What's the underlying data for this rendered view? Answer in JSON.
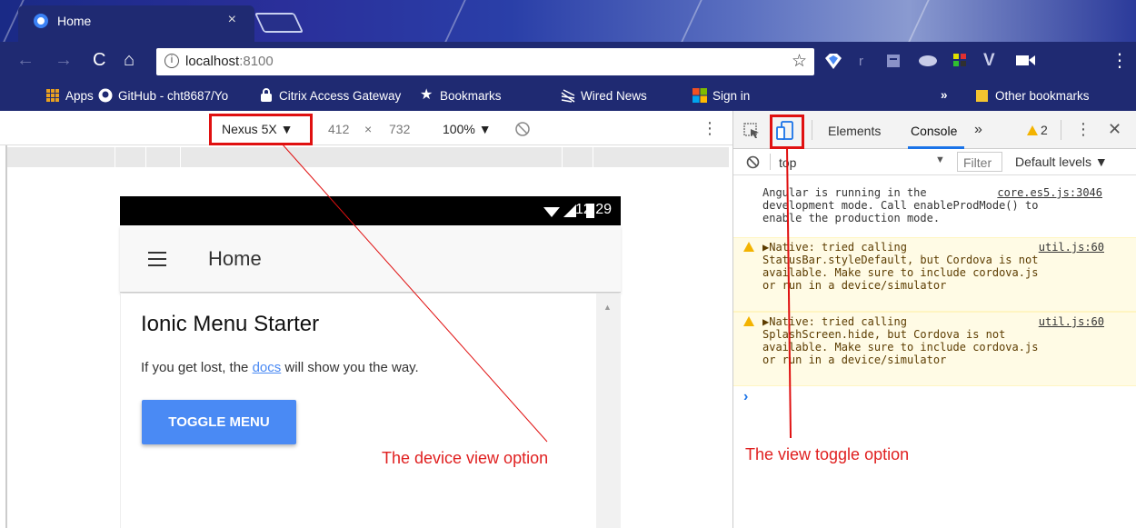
{
  "browser": {
    "tab": {
      "title": "Home",
      "close": "×"
    },
    "address": {
      "host": "localhost",
      "port": ":8100"
    },
    "bookmarks": [
      {
        "label": "Apps",
        "icon": "apps-grid-icon"
      },
      {
        "label": "GitHub - cht8687/Yo",
        "icon": "github-icon"
      },
      {
        "label": "Citrix Access Gateway",
        "icon": "citrix-icon"
      },
      {
        "label": "Bookmarks",
        "icon": "star-icon"
      },
      {
        "label": "Wired News",
        "icon": "wired-icon"
      },
      {
        "label": "Sign in",
        "icon": "windows-icon"
      }
    ],
    "bookmarks_more": "»",
    "other_bookmarks": "Other bookmarks"
  },
  "device_toolbar": {
    "device": "Nexus 5X ▼",
    "width": "412",
    "times": "×",
    "height": "732",
    "zoom": "100% ▼",
    "more": "⋮"
  },
  "phone": {
    "time": "12:29",
    "header_title": "Home",
    "page_title": "Ionic Menu Starter",
    "text_before": "If you get lost, the ",
    "link": "docs",
    "text_after": " will show you the way.",
    "button": "TOGGLE MENU"
  },
  "devtools": {
    "tabs": [
      "Elements",
      "Console"
    ],
    "more_tabs": "»",
    "warning_count": "2",
    "context": "top",
    "filter_placeholder": "Filter",
    "levels": "Default levels ▼",
    "messages": [
      {
        "type": "info",
        "lines": [
          "Angular is running in the",
          "development mode. Call enableProdMode() to",
          "enable the production mode."
        ],
        "source": "core.es5.js:3046"
      },
      {
        "type": "warning",
        "lines": [
          "▶Native: tried calling",
          "StatusBar.styleDefault, but Cordova is not",
          "available. Make sure to include cordova.js",
          "or run in a device/simulator"
        ],
        "source": "util.js:60"
      },
      {
        "type": "warning",
        "lines": [
          "▶Native: tried calling",
          "SplashScreen.hide, but Cordova is not",
          "available. Make sure to include cordova.js",
          "or run in a device/simulator"
        ],
        "source": "util.js:60"
      }
    ],
    "prompt": "›"
  },
  "annotations": {
    "device_view": "The device view option",
    "view_toggle": "The view toggle option"
  },
  "colors": {
    "chrome_dark": "#1f2a72",
    "annotation_red": "#e01010",
    "ionic_blue": "#4a8af4",
    "devtools_blue": "#1a73e8"
  }
}
